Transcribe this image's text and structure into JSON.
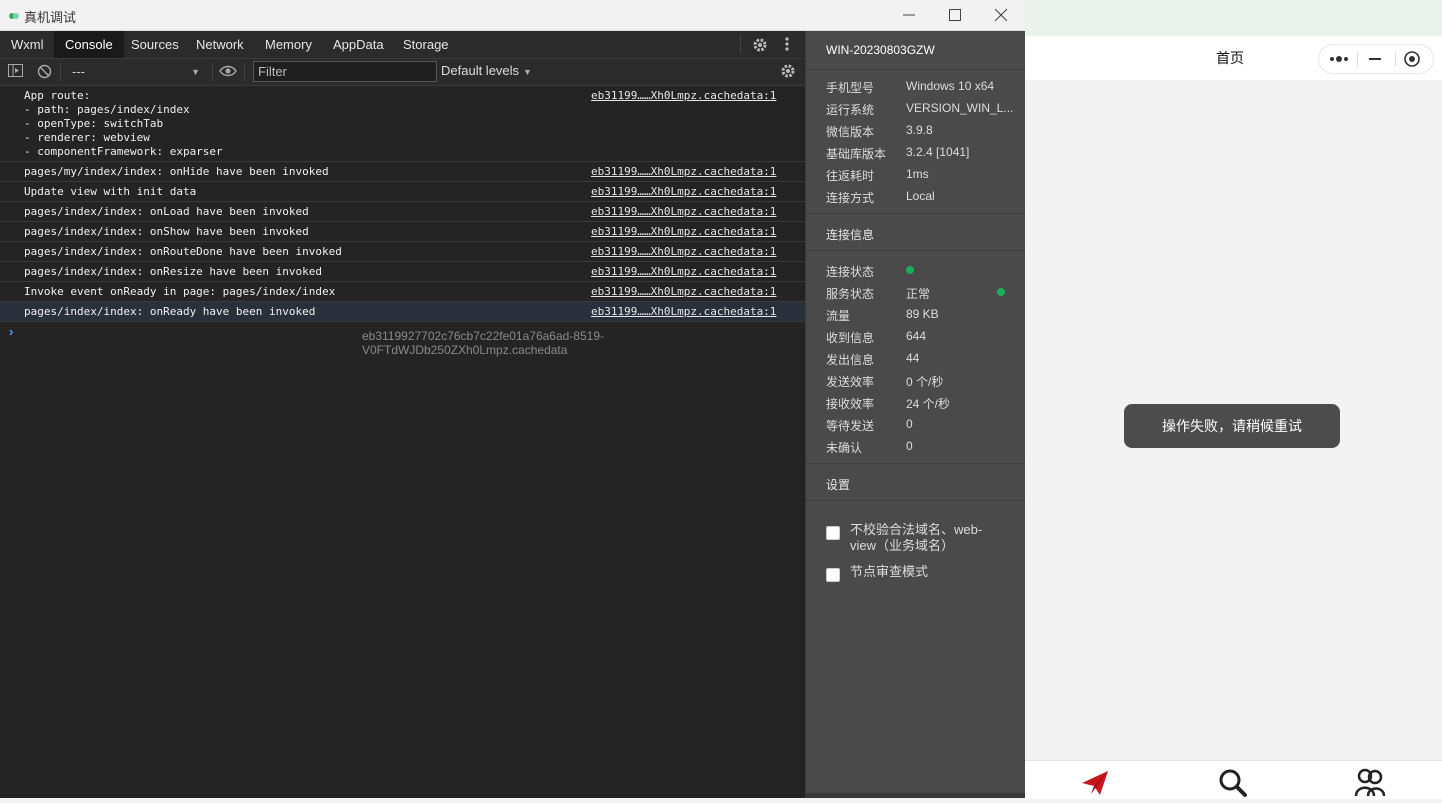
{
  "window": {
    "title": "真机调试",
    "controls": [
      "minimize",
      "maximize",
      "close"
    ]
  },
  "tabs": [
    {
      "label": "Wxml"
    },
    {
      "label": "Console",
      "active": true
    },
    {
      "label": "Sources"
    },
    {
      "label": "Network"
    },
    {
      "label": "Memory"
    },
    {
      "label": "AppData"
    },
    {
      "label": "Storage"
    }
  ],
  "toolbar": {
    "context_value": "---",
    "filter_placeholder": "Filter",
    "levels_label": "Default levels"
  },
  "console": {
    "rows": [
      {
        "message": "App route:\n- path: pages/index/index\n- openType: switchTab\n- renderer: webview\n- componentFramework: exparser",
        "source": "eb31199……Xh0Lmpz.cachedata:1"
      },
      {
        "message": "pages/my/index/index: onHide have been invoked",
        "source": "eb31199……Xh0Lmpz.cachedata:1"
      },
      {
        "message": "Update view with init data",
        "source": "eb31199……Xh0Lmpz.cachedata:1"
      },
      {
        "message": "pages/index/index: onLoad have been invoked",
        "source": "eb31199……Xh0Lmpz.cachedata:1"
      },
      {
        "message": "pages/index/index: onShow have been invoked",
        "source": "eb31199……Xh0Lmpz.cachedata:1"
      },
      {
        "message": "pages/index/index: onRouteDone have been invoked",
        "source": "eb31199……Xh0Lmpz.cachedata:1"
      },
      {
        "message": "pages/index/index: onResize have been invoked",
        "source": "eb31199……Xh0Lmpz.cachedata:1"
      },
      {
        "message": "Invoke event onReady in page: pages/index/index",
        "source": "eb31199……Xh0Lmpz.cachedata:1"
      },
      {
        "message": "pages/index/index: onReady have been invoked",
        "source": "eb31199……Xh0Lmpz.cachedata:1",
        "selected": true
      }
    ],
    "prompt": "›",
    "bottom_source": "eb3119927702c76cb7c22fe01a76a6ad-8519-V0FTdWJDb250ZXh0Lmpz.cachedata"
  },
  "device_panel": {
    "device_name": "WIN-20230803GZW",
    "info": [
      {
        "label": "手机型号",
        "value": "Windows 10 x64"
      },
      {
        "label": "运行系统",
        "value": "VERSION_WIN_L..."
      },
      {
        "label": "微信版本",
        "value": "3.9.8"
      },
      {
        "label": "基础库版本",
        "value": "3.2.4 [1041]"
      },
      {
        "label": "往返耗时",
        "value": "1ms"
      },
      {
        "label": "连接方式",
        "value": "Local"
      }
    ],
    "conn_header": "连接信息",
    "conn": [
      {
        "label": "连接状态",
        "value": ""
      },
      {
        "label": "服务状态",
        "value": "正常"
      },
      {
        "label": "流量",
        "value": "89 KB"
      },
      {
        "label": "收到信息",
        "value": "644"
      },
      {
        "label": "发出信息",
        "value": "44"
      },
      {
        "label": "发送效率",
        "value": "0 个/秒"
      },
      {
        "label": "接收效率",
        "value": "24 个/秒"
      },
      {
        "label": "等待发送",
        "value": "0"
      },
      {
        "label": "未确认",
        "value": "0"
      }
    ],
    "settings_header": "设置",
    "settings": [
      {
        "label": "不校验合法域名、web-view（业务域名）",
        "checked": false
      },
      {
        "label": "节点审查模式",
        "checked": false
      }
    ],
    "status_color": "#1aad5b"
  },
  "phone": {
    "nav_title": "首页",
    "toast": "操作失败，请稍候重试",
    "tabbar_icons": [
      "send-icon",
      "search-icon",
      "user-group-icon"
    ],
    "accent": "#c8161d"
  }
}
